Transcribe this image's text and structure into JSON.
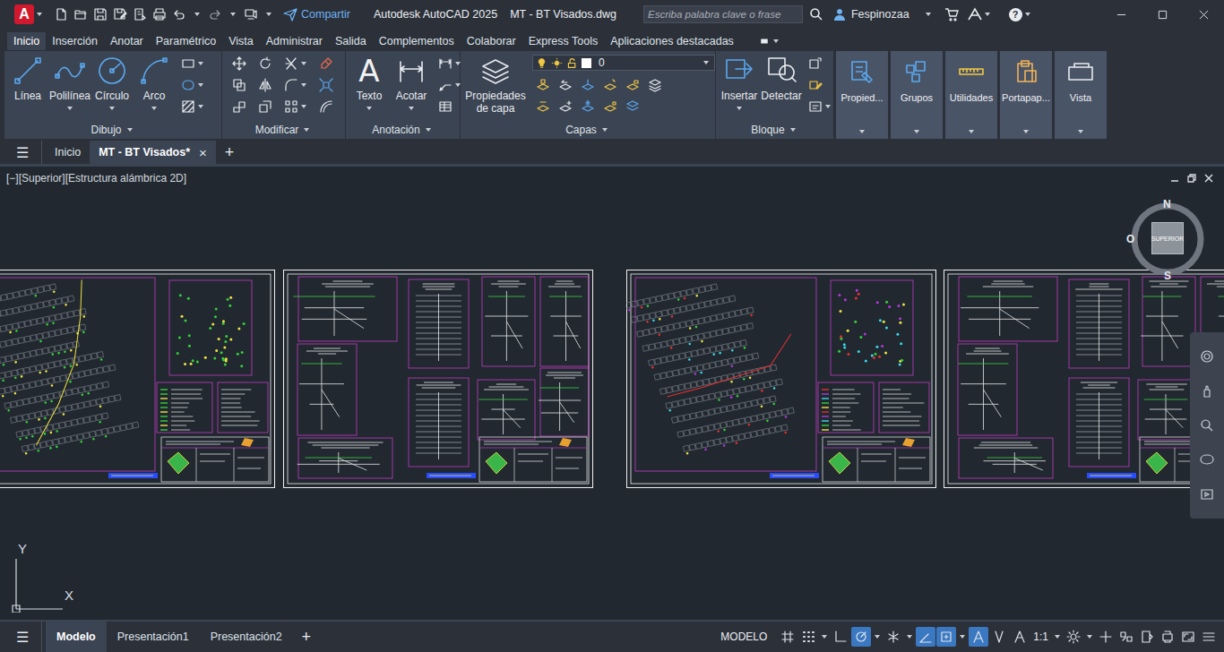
{
  "window": {
    "logo": "A",
    "share": "Compartir",
    "app_title": "Autodesk AutoCAD 2025",
    "file_title": "MT - BT Visados.dwg",
    "search_placeholder": "Escriba palabra clave o frase",
    "user": "Fespinozaa",
    "help": "?"
  },
  "ribbon_tabs": [
    {
      "label": "Inicio",
      "selected": true
    },
    {
      "label": "Inserción",
      "selected": false
    },
    {
      "label": "Anotar",
      "selected": false
    },
    {
      "label": "Paramétrico",
      "selected": false
    },
    {
      "label": "Vista",
      "selected": false
    },
    {
      "label": "Administrar",
      "selected": false
    },
    {
      "label": "Salida",
      "selected": false
    },
    {
      "label": "Complementos",
      "selected": false
    },
    {
      "label": "Colaborar",
      "selected": false
    },
    {
      "label": "Express Tools",
      "selected": false
    },
    {
      "label": "Aplicaciones destacadas",
      "selected": false
    }
  ],
  "panels": {
    "dibujo": {
      "title": "Dibujo",
      "tools": [
        "Línea",
        "Polilínea",
        "Círculo",
        "Arco"
      ]
    },
    "modificar": {
      "title": "Modificar"
    },
    "anotacion": {
      "title": "Anotación",
      "tools": [
        {
          "label": "Texto",
          "glyph": "A"
        },
        {
          "label": "Acotar"
        }
      ]
    },
    "capas": {
      "title": "Capas",
      "tool": "Propiedades de capa",
      "layer": "0"
    },
    "bloque": {
      "title": "Bloque",
      "tools": [
        "Insertar",
        "Detectar"
      ]
    },
    "collapsed": [
      "Propied...",
      "Grupos",
      "Utilidades",
      "Portapap...",
      "Vista"
    ]
  },
  "file_tabs": {
    "menu": "☰",
    "tabs": [
      {
        "label": "Inicio",
        "selected": false
      },
      {
        "label": "MT - BT Visados*",
        "selected": true
      }
    ],
    "close": "×",
    "add": "+"
  },
  "viewport": {
    "label": "[−][Superior][Estructura alámbrica 2D]",
    "viewcube": {
      "north": "N",
      "west": "O",
      "south": "S",
      "face": "SUPERIOR"
    },
    "ucs": {
      "y": "Y",
      "x": "X"
    }
  },
  "layout_tabs": {
    "menu": "☰",
    "tabs": [
      {
        "label": "Modelo",
        "selected": true
      },
      {
        "label": "Presentación1",
        "selected": false
      },
      {
        "label": "Presentación2",
        "selected": false
      }
    ],
    "add": "+"
  },
  "status_bar": {
    "mode": "MODELO",
    "toggles": [
      {
        "kind": "grid",
        "on": false
      },
      {
        "kind": "snap",
        "on": false
      },
      {
        "kind": "ortho",
        "on": false
      },
      {
        "kind": "polar",
        "on": true
      },
      {
        "kind": "isodraft",
        "on": false
      },
      {
        "kind": "otrack",
        "on": true
      },
      {
        "kind": "osnap",
        "on": true
      },
      {
        "kind": "annovis",
        "on": true
      },
      {
        "kind": "autoscale",
        "on": false
      },
      {
        "kind": "annoscale",
        "on": false
      }
    ],
    "scale": "1:1"
  }
}
